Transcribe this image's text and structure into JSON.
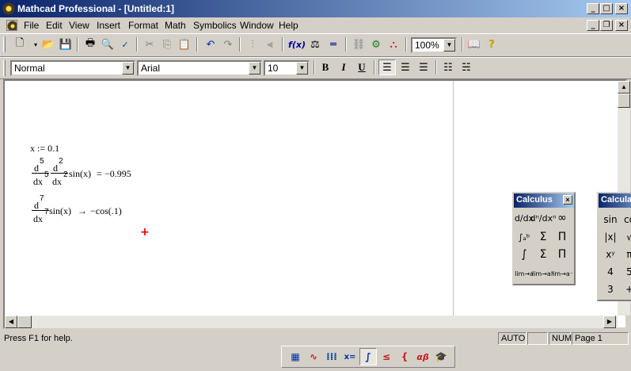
{
  "window": {
    "title": "Mathcad Professional - [Untitled:1]",
    "controls": {
      "minimize": "_",
      "maximize": "□",
      "close": "×",
      "restore": "❐"
    }
  },
  "menu": {
    "items": [
      "File",
      "Edit",
      "View",
      "Insert",
      "Format",
      "Math",
      "Symbolics",
      "Window",
      "Help"
    ],
    "accelerators": [
      "F",
      "E",
      "V",
      "I",
      "o",
      "M",
      "S",
      "W",
      "H"
    ]
  },
  "toolbar": {
    "zoom": "100%",
    "icons": [
      "new-icon",
      "open-icon",
      "save-icon",
      "print-icon",
      "print-preview-icon",
      "spell-check-icon",
      "cut-icon",
      "copy-icon",
      "paste-icon",
      "undo-icon",
      "redo-icon",
      "align-across-icon",
      "align-down-icon",
      "insert-function-icon",
      "insert-unit-icon",
      "calculate-icon",
      "insert-hyperlink-icon",
      "component-wizard-icon",
      "mathconnex-icon",
      "resource-center-icon",
      "help-icon"
    ],
    "function_label": "f(x)",
    "help_glyph": "?"
  },
  "formatting": {
    "style": "Normal",
    "font": "Arial",
    "size": "10",
    "bold": "B",
    "italic": "I",
    "underline": "U"
  },
  "worksheet": {
    "assignment": "x := 0.1",
    "expr1": {
      "outer_d": "d",
      "outer_order": "5",
      "outer_dx": "dx",
      "outer_dx_order": "5",
      "inner_d": "d",
      "inner_order": "2",
      "inner_dx": "dx",
      "inner_dx_order": "2",
      "func": "sin(x)",
      "eq": "=",
      "result": "−0.995"
    },
    "expr2": {
      "d": "d",
      "order": "7",
      "dx": "dx",
      "dx_order": "7",
      "func": "sin(x)",
      "arrow": "→",
      "result": "−cos(.1)"
    },
    "cursor": "+"
  },
  "palettes": {
    "calculus1": {
      "title": "Calculus",
      "buttons": [
        [
          "d/dx",
          "dⁿ/dxⁿ",
          "∞"
        ],
        [
          "∫ₐᵇ",
          "Σ",
          "Π"
        ],
        [
          "∫",
          "Σ",
          "Π"
        ],
        [
          "lim→a",
          "lim→a⁺",
          "lim→a⁻"
        ]
      ]
    },
    "calculus2": {
      "title": "Calcula",
      "buttons": [
        "sin",
        "co",
        "|x|",
        "√",
        "xʸ",
        "π",
        "4",
        "5",
        "3",
        "+"
      ]
    }
  },
  "status": {
    "help": "Press F1 for help.",
    "mode": "AUTO",
    "cap": "",
    "num": "NUM",
    "page": "Page 1"
  },
  "math_toolbar": {
    "buttons": [
      "calculator-icon",
      "graph-icon",
      "matrix-icon",
      "evaluation-icon",
      "calculus-icon",
      "boolean-icon",
      "programming-icon",
      "greek-icon",
      "symbolic-icon"
    ],
    "labels": {
      "evaluation": "x=",
      "greek": "αβ",
      "graph": "∿",
      "boolean": "≤",
      "programming": "{",
      "calculus": "∫"
    }
  }
}
